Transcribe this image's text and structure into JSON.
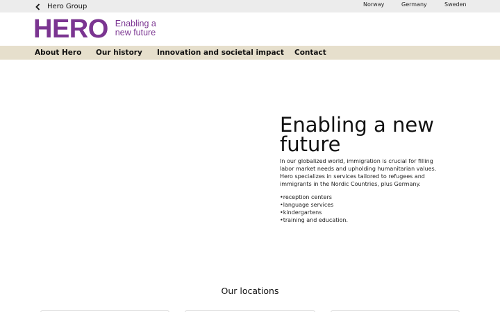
{
  "topbar": {
    "back_label": "Hero Group",
    "countries": [
      "Norway",
      "Germany",
      "Sweden"
    ]
  },
  "logo": {
    "mark": "HERO",
    "tagline": "Enabling a new future"
  },
  "nav": {
    "items": [
      "About Hero",
      "Our history",
      "Innovation and societal impact",
      "Contact"
    ]
  },
  "hero": {
    "title": "Enabling a new future",
    "intro": "In our globalized world, immigration is crucial for filling labor market needs and upholding humanitarian values. Hero specializes in services tailored to refugees and immigrants in the Nordic Countries, plus Germany.",
    "services": [
      "reception centers",
      "language services",
      "kindergartens",
      "training and education."
    ]
  },
  "locations": {
    "title": "Our locations"
  },
  "colors": {
    "brand": "#7b3591",
    "nav_bg": "#e6dfcc",
    "topbar_bg": "#ececec"
  },
  "icons": {
    "back": "chevron-left-icon"
  }
}
